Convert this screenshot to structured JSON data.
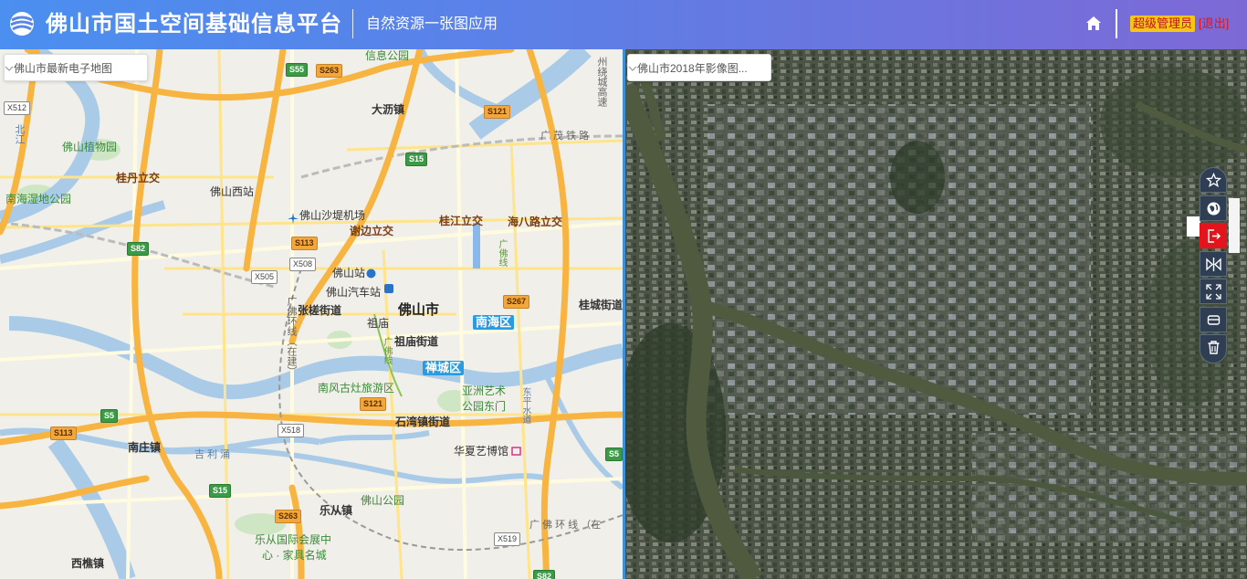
{
  "header": {
    "title": "佛山市国土空间基础信息平台",
    "subtitle": "自然资源一张图应用",
    "role": "超级管理员",
    "logout": "[退出]"
  },
  "left_map": {
    "layer_selected": "佛山市最新电子地图",
    "labels": {
      "fs_botanic": "佛山植物园",
      "guidan": "桂丹立交",
      "fs_west": "佛山西站",
      "nanhai_wetland": "南海湿地公园",
      "shadi": "佛山沙堤机场",
      "xiebian": "谢边立交",
      "guijiang": "桂江立交",
      "haiba": "海八路立交",
      "dali": "大沥镇",
      "fs_station": "佛山站",
      "fs_bus": "佛山汽车站",
      "zhangcha": "张槎街道",
      "fs_city": "佛山市",
      "nanhai_dist": "南海区",
      "zumiao": "祖庙",
      "zumiao_st": "祖庙街道",
      "chancheng": "禅城区",
      "nanfeng": "南风古灶旅游区",
      "asia_art": "亚洲艺术",
      "asia_art2": "公园东门",
      "shiwan": "石湾镇街道",
      "guicheng": "桂城街道",
      "nanzhuang": "南庄镇",
      "huaxia": "华夏艺博馆",
      "fs_park": "佛山公园",
      "lecong": "乐从镇",
      "lecong_expo": "乐从国际会展中",
      "lecong_expo2": "心 · 家具名城",
      "xiqiao": "西樵镇",
      "guangfo_ring": "广佛环线（在建）",
      "guangfo_ring2": "广 佛 环 线 （在",
      "guangmao": "广 茂 铁 路",
      "jisheng": "吉 利 涌",
      "xindu": "信息公园",
      "guangfo_line": "广佛线",
      "guangfo_line2": "广佛线",
      "rail_vertical": "州绕城高速",
      "river_bei": "北江",
      "river_dong": "东平水道"
    },
    "shields": [
      "S55",
      "S263",
      "X512",
      "S121",
      "S15",
      "S82",
      "S113",
      "X508",
      "X505",
      "S267",
      "S5",
      "S113",
      "X518",
      "S121",
      "S15",
      "S263",
      "X519",
      "S82",
      "S5"
    ]
  },
  "right_map": {
    "layer_selected": "佛山市2018年影像图..."
  },
  "tools": {
    "favorite": "favorite",
    "globe": "globe",
    "exit": "exit",
    "compare": "compare",
    "fullscreen": "fullscreen",
    "clear": "clear",
    "delete": "delete"
  },
  "colors": {
    "header_start": "#4b8ff0",
    "header_end": "#7d69d6",
    "divider": "#3e8fd5",
    "tool_bg": "#2f3e52",
    "exit_red": "#e3141b"
  }
}
